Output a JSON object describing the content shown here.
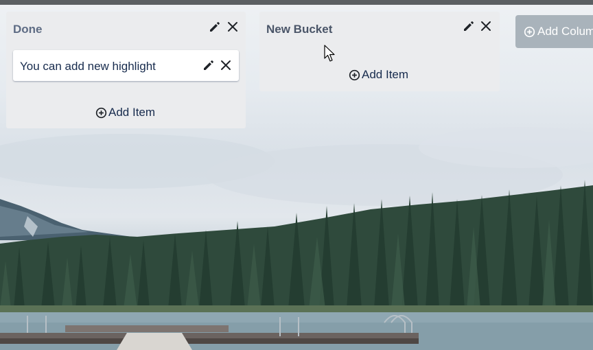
{
  "board": {
    "columns": [
      {
        "title": "Done",
        "cards": [
          {
            "text": "You can add new highlight"
          }
        ],
        "add_item_label": "Add Item"
      },
      {
        "title": "New Bucket",
        "cards": [],
        "add_item_label": "Add Item"
      }
    ],
    "add_column_label": "Add Colum"
  },
  "icons": {
    "edit": "pencil-icon",
    "delete": "close-icon",
    "add": "plus-circle-icon",
    "cursor": "mouse-pointer-icon"
  },
  "colors": {
    "column_bg": "#ebecee",
    "card_bg": "#ffffff",
    "add_column_bg": "#a9b3bb",
    "title_text": "#5e6c84",
    "body_text": "#172b4d"
  }
}
